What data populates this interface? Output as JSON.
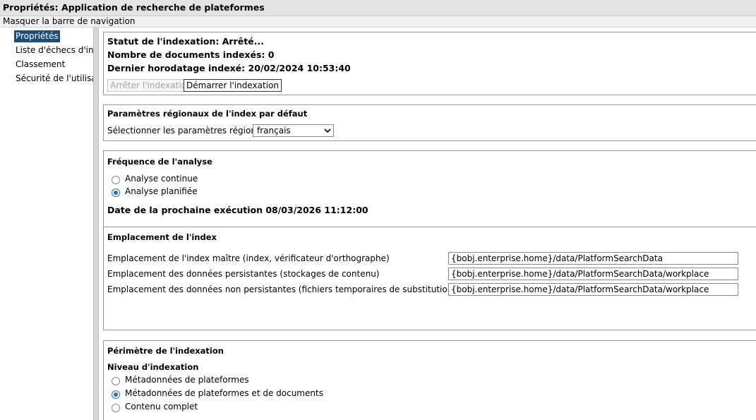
{
  "window": {
    "title": "Propriétés: Application de recherche de plateformes",
    "nav_toggle": "Masquer la barre de navigation"
  },
  "sidebar": {
    "items": [
      {
        "label": "Propriétés",
        "selected": true
      },
      {
        "label": "Liste d'échecs d'index"
      },
      {
        "label": "Classement"
      },
      {
        "label": "Sécurité de l'utilisateur"
      }
    ]
  },
  "status": {
    "indexing_status": "Statut de l'indexation: Arrêté...",
    "documents_indexed": "Nombre de documents indexés: 0",
    "last_timestamp": "Dernier horodatage indexé: 20/02/2024 10:53:40",
    "stop_button": "Arrêter l'indexation",
    "start_button": "Démarrer l'indexation"
  },
  "locale": {
    "title": "Paramètres régionaux de l'index par défaut",
    "select_label": "Sélectionner les paramètres régionaux :",
    "selected_value": "français"
  },
  "frequency": {
    "title": "Fréquence de l'analyse",
    "options": [
      {
        "label": "Analyse continue",
        "checked": false
      },
      {
        "label": "Analyse planifiée",
        "checked": true
      }
    ],
    "next_run": "Date de la prochaine exécution 08/03/2026 11:12:00"
  },
  "index_location": {
    "title": "Emplacement de l'index",
    "rows": [
      {
        "label": "Emplacement de l'index maître (index, vérificateur d'orthographe)",
        "value": "{bobj.enterprise.home}/data/PlatformSearchData"
      },
      {
        "label": "Emplacement des données persistantes (stockages de contenu)",
        "value": "{bobj.enterprise.home}/data/PlatformSearchData/workplace"
      },
      {
        "label": "Emplacement des données non persistantes (fichiers temporaires de substitution, index Delta)",
        "value": "{bobj.enterprise.home}/data/PlatformSearchData/workplace"
      }
    ]
  },
  "scope": {
    "title": "Périmètre de l'indexation",
    "level_title": "Niveau d'indexation",
    "options": [
      {
        "label": "Métadonnées de plateformes",
        "checked": false
      },
      {
        "label": "Métadonnées de plateformes et de documents",
        "checked": true
      },
      {
        "label": "Contenu complet",
        "checked": false
      }
    ]
  },
  "colors": {
    "selected_nav": "#1c4b7d",
    "radio_accent": "#1f6fd1"
  }
}
